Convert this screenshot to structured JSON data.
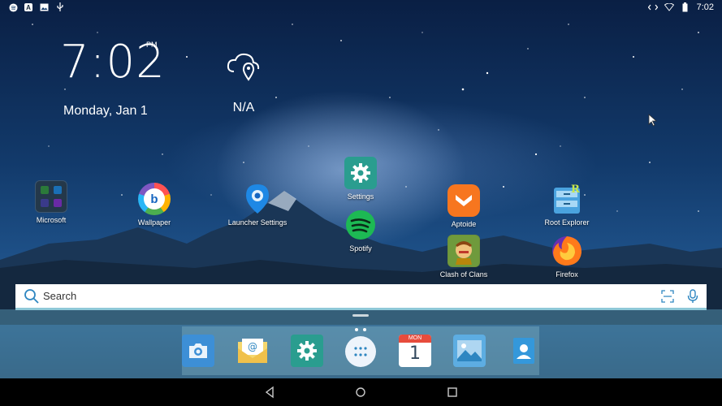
{
  "status_bar": {
    "time": "7:02",
    "left_icons": [
      "spotify-icon",
      "aptoide-icon",
      "image-icon",
      "usb-icon"
    ],
    "right_icons": [
      "code-icon",
      "wifi-icon",
      "battery-icon"
    ]
  },
  "clock_widget": {
    "time": "7:02",
    "ampm": "PM",
    "date": "Monday, Jan 1"
  },
  "weather_widget": {
    "icon": "cloud-location-icon",
    "text": "N/A"
  },
  "apps": [
    {
      "name": "Microsoft",
      "icon": "microsoft-folder-icon"
    },
    {
      "name": "Wallpaper",
      "icon": "wallpaper-icon"
    },
    {
      "name": "Launcher Settings",
      "icon": "launcher-settings-icon"
    },
    {
      "name": "Settings",
      "icon": "settings-icon"
    },
    {
      "name": "Spotify",
      "icon": "spotify-icon"
    },
    {
      "name": "Aptoide",
      "icon": "aptoide-icon"
    },
    {
      "name": "Clash of Clans",
      "icon": "clash-of-clans-icon"
    },
    {
      "name": "Root Explorer",
      "icon": "root-explorer-icon"
    },
    {
      "name": "Firefox",
      "icon": "firefox-icon"
    }
  ],
  "search": {
    "placeholder": "Search"
  },
  "dock": {
    "items": [
      "camera-icon",
      "email-icon",
      "settings-icon",
      "app-drawer-icon",
      "calendar-icon",
      "gallery-icon",
      "contacts-icon"
    ],
    "calendar_month": "MON",
    "calendar_day": "1"
  },
  "nav": {
    "buttons": [
      "back-icon",
      "home-icon",
      "recents-icon"
    ]
  },
  "colors": {
    "accent_teal": "#2a9d8f",
    "search_border": "#8fc8d8",
    "firefox_orange": "#ff7a1a",
    "aptoide_orange": "#f7761f"
  }
}
